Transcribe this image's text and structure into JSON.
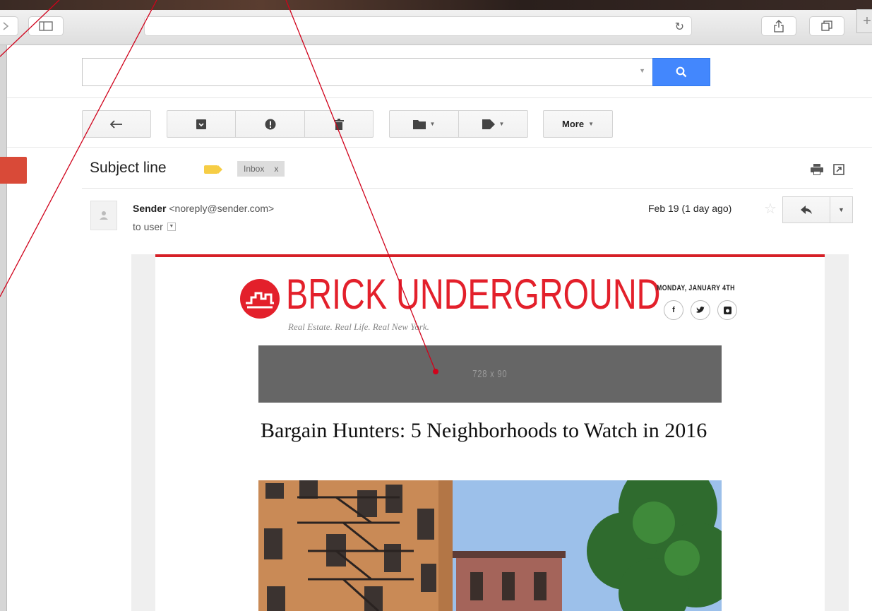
{
  "gmail": {
    "search_placeholder": "",
    "toolbar": {
      "more_label": "More"
    },
    "subject": "Subject line",
    "inbox_chip": "Inbox",
    "inbox_chip_close": "x",
    "sender_name": "Sender",
    "sender_email": "<noreply@sender.com>",
    "to_line": "to user",
    "date": "Feb 19 (1 day ago)"
  },
  "newsletter": {
    "logo_text": "BRICK UNDERGROUND",
    "tagline": "Real Estate. Real Life. Real New York.",
    "issue_date": "MONDAY, JANUARY 4TH",
    "social": [
      "f",
      "t",
      "ig"
    ],
    "ad_label": "728 x 90",
    "headline": "Bargain Hunters: 5 Neighborhoods to Watch in 2016"
  },
  "colors": {
    "brand_red": "#e3202b",
    "search_blue": "#4387fd",
    "annotation_red": "#d0021b"
  }
}
